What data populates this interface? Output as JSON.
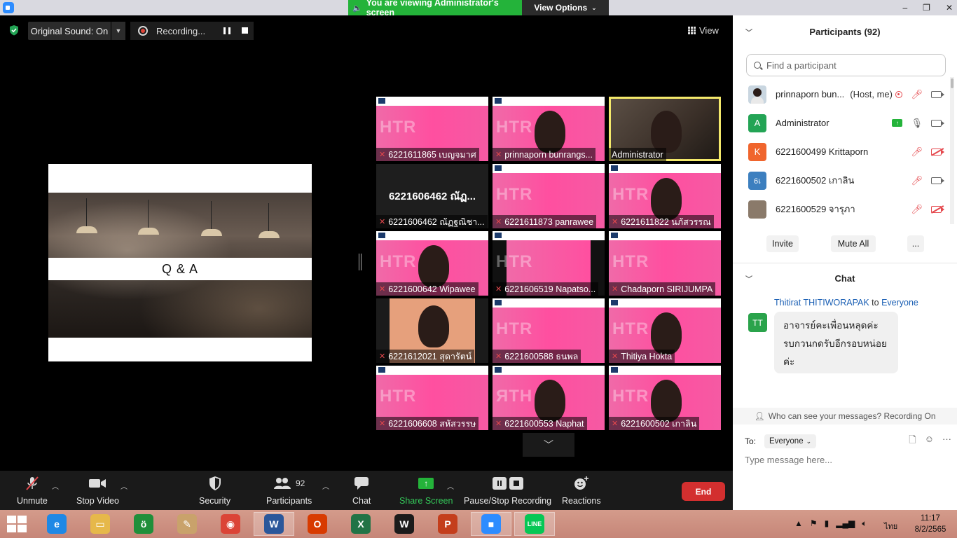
{
  "titlebar": {
    "viewing_banner": "You are viewing Administrator's screen",
    "view_options": "View Options",
    "window_controls": [
      "–",
      "❐",
      "✕"
    ]
  },
  "top_strip": {
    "original_sound": "Original Sound: On",
    "recording": "Recording...",
    "view": "View"
  },
  "shared_screen": {
    "slide_title": "Q & A"
  },
  "tiles": [
    {
      "name": "6221611865 เบญจมาศ",
      "htr": "HTR",
      "style": "pink"
    },
    {
      "name": "prinnaporn bunrangs...",
      "htr": "HTR",
      "style": "pink-face"
    },
    {
      "name": "Administrator",
      "htr": "",
      "style": "admin"
    },
    {
      "name": "6221606462 ณัฏฐณิชา...",
      "big": "6221606462 ณัฏ...",
      "style": "dark"
    },
    {
      "name": "6221611873 panrawee",
      "htr": "HTR",
      "style": "pink"
    },
    {
      "name": "6221611822 นภัสวรรณ",
      "htr": "HTR",
      "style": "pink-face"
    },
    {
      "name": "6221600642 Wipawee",
      "htr": "HTR",
      "style": "pink-face"
    },
    {
      "name": "6221606519 Napatso...",
      "htr": "HTR",
      "style": "split"
    },
    {
      "name": "Chadaporn SIRIJUMPA",
      "htr": "HTR",
      "style": "pink"
    },
    {
      "name": "6221612021 สุดารัตน์",
      "htr": "",
      "style": "face"
    },
    {
      "name": "6221600588 ธนพล",
      "htr": "HTR",
      "style": "pink"
    },
    {
      "name": "Thitiya Hokta",
      "htr": "HTR",
      "style": "pink-face"
    },
    {
      "name": "6221606608 สหัสวรรษ",
      "htr": "HTR",
      "style": "pink"
    },
    {
      "name": "6221600553 Naphat",
      "htr": "ЯTH",
      "style": "pink-face"
    },
    {
      "name": "6221600502 เกาลิน",
      "htr": "HTR",
      "style": "pink-face"
    }
  ],
  "toolbar": {
    "unmute": "Unmute",
    "stop_video": "Stop Video",
    "security": "Security",
    "participants": "Participants",
    "participants_count": "92",
    "chat": "Chat",
    "share_screen": "Share Screen",
    "pause_stop_recording": "Pause/Stop Recording",
    "reactions": "Reactions",
    "end": "End"
  },
  "participants_panel": {
    "title": "Participants (92)",
    "search_placeholder": "Find a participant",
    "list": [
      {
        "name": "prinnaporn bun...",
        "role": "(Host, me)",
        "avatar": "",
        "avatar_color": "#c9d6e0"
      },
      {
        "name": "Administrator",
        "role": "",
        "avatar": "A",
        "avatar_color": "#23a455"
      },
      {
        "name": "6221600499 Krittaporn",
        "role": "",
        "avatar": "K",
        "avatar_color": "#f0652d"
      },
      {
        "name": "6221600502 เกาลิน",
        "role": "",
        "avatar": "6เ",
        "avatar_color": "#3c7fbf"
      },
      {
        "name": "6221600529 จารุภา",
        "role": "",
        "avatar": "",
        "avatar_color": "#8a7a6a"
      }
    ],
    "invite": "Invite",
    "mute_all": "Mute All",
    "more": "..."
  },
  "chat_panel": {
    "title": "Chat",
    "sender": "Thitirat THITIWORAPAK",
    "to_word": "to",
    "recipient": "Everyone",
    "avatar": "TT",
    "message_lines": [
      "อาจารย์คะเพื่อนหลุดค่ะ",
      "รบกวนกดรับอีกรอบหน่อย",
      "ค่ะ"
    ],
    "who_can_see": "Who can see your messages? Recording On",
    "to_label": "To:",
    "to_value": "Everyone",
    "input_placeholder": "Type message here..."
  },
  "taskbar": {
    "language": "ไทย",
    "time": "11:17",
    "date": "8/2/2565",
    "apps": [
      {
        "name": "internet-explorer",
        "color": "#1e88e5",
        "glyph": "e"
      },
      {
        "name": "file-explorer",
        "color": "#e6b84a",
        "glyph": "▭"
      },
      {
        "name": "app-green-circle",
        "color": "#1f8f3a",
        "glyph": "ö"
      },
      {
        "name": "paint",
        "color": "#c9a26b",
        "glyph": "✎"
      },
      {
        "name": "chrome",
        "color": "#db4437",
        "glyph": "◉"
      },
      {
        "name": "word",
        "color": "#2b579a",
        "glyph": "W"
      },
      {
        "name": "office",
        "color": "#d83b01",
        "glyph": "O"
      },
      {
        "name": "excel",
        "color": "#217346",
        "glyph": "X"
      },
      {
        "name": "webex",
        "color": "#1b1b1b",
        "glyph": "W"
      },
      {
        "name": "powerpoint",
        "color": "#c43e1c",
        "glyph": "P"
      },
      {
        "name": "zoom",
        "color": "#2d8cff",
        "glyph": "■"
      },
      {
        "name": "line",
        "color": "#06c755",
        "glyph": "LINE"
      }
    ]
  }
}
